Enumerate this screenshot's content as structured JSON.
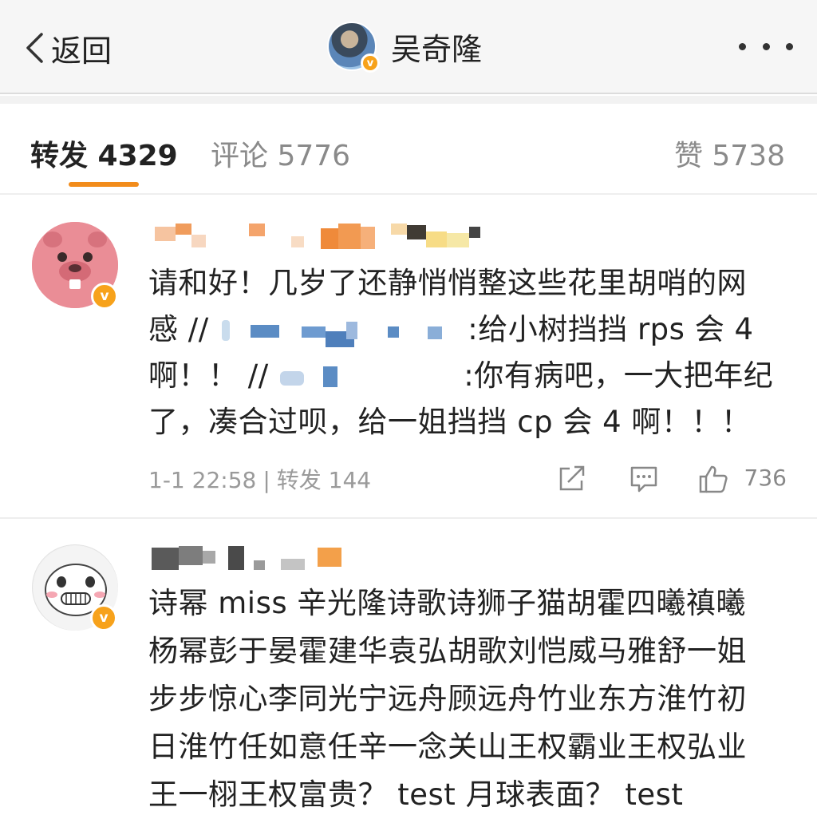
{
  "header": {
    "back_label": "返回",
    "title": "吴奇隆",
    "badge": "v"
  },
  "tabs": {
    "repost": "转发 4329",
    "comment": "评论 5776",
    "like": "赞 5738"
  },
  "colors": {
    "accent": "#f28c1b",
    "verified_badge": "#f7a21b"
  },
  "posts": [
    {
      "line1": "请和好！几岁了还静悄悄整这些花里胡哨的网",
      "line2_start": "感 //",
      "line2_end": ":给小树挡挡 rps 会 4",
      "line3_start": "啊！！ //",
      "line3_end": ":你有病吧，一大把年纪",
      "line4": "了，凑合过呗，给一姐挡挡 cp 会 4 啊！！！",
      "time": "1-1 22:58",
      "repost_label": "转发 144",
      "likes": "736"
    },
    {
      "lines": [
        "诗幂 miss 辛光隆诗歌诗狮子猫胡霍四曦禛曦",
        "杨幂彭于晏霍建华袁弘胡歌刘恺威马雅舒一姐",
        "步步惊心李同光宁远舟顾远舟竹业东方淮竹初",
        "日淮竹任如意任辛一念关山王权霸业王权弘业",
        "王一栩王权富贵？ test 月球表面？ test"
      ]
    }
  ],
  "icons": {
    "back": "chevron-left-icon",
    "more": "more-dots-icon",
    "share": "share-icon",
    "comment": "comment-icon",
    "like": "thumbs-up-icon"
  }
}
